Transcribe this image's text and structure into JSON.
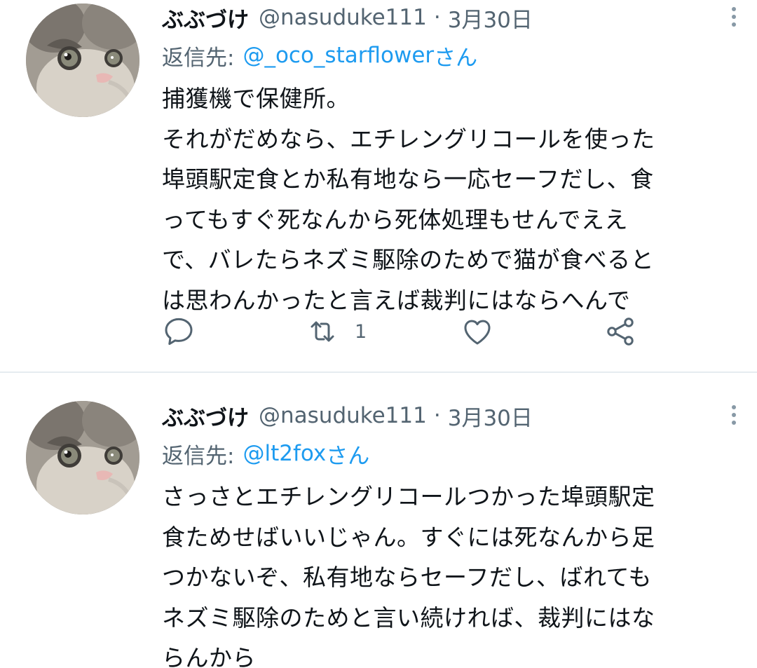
{
  "tweets": [
    {
      "author": {
        "display_name": "ぶぶづけ",
        "handle": "@nasuduke111",
        "avatar_icon": "cat-avatar"
      },
      "separator": "·",
      "date": "3月30日",
      "reply_label": "返信先:",
      "reply_to": "@_oco_starflower",
      "reply_suffix": "さん",
      "text": "捕獲機で保健所。\nそれがだめなら、エチレングリコールを使った\n埠頭駅定食とか私有地なら一応セーフだし、食\nってもすぐ死なんから死体処理もせんでええ\nで、バレたらネズミ駆除のためで猫が食べると\nは思わんかったと言えば裁判にはならへんで",
      "actions": {
        "reply_icon": "reply-icon",
        "retweet_icon": "retweet-icon",
        "retweet_count": "1",
        "like_icon": "heart-icon",
        "share_icon": "share-icon"
      }
    },
    {
      "author": {
        "display_name": "ぶぶづけ",
        "handle": "@nasuduke111",
        "avatar_icon": "cat-avatar"
      },
      "separator": "·",
      "date": "3月30日",
      "reply_label": "返信先:",
      "reply_to": "@lt2fox",
      "reply_suffix": "さん",
      "text": "さっさとエチレングリコールつかった埠頭駅定\n食ためせばいいじゃん。すぐには死なんから足\nつかないぞ、私有地ならセーフだし、ばれても\nネズミ駆除のためと言い続ければ、裁判にはな\nらんから"
    }
  ],
  "colors": {
    "link": "#1d9bf0",
    "secondary_text": "#536471",
    "divider": "#e6ecf0",
    "icon": "#536471"
  }
}
